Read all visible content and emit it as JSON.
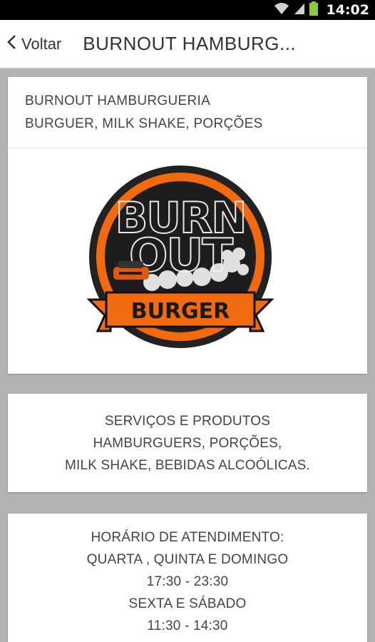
{
  "status_bar": {
    "time": "14:02"
  },
  "header": {
    "back_label": "Voltar",
    "title": "BURNOUT HAMBURG..."
  },
  "intro_card": {
    "lines": [
      "BURNOUT HAMBURGUERIA",
      "BURGUER, MILK SHAKE, PORÇÕES"
    ],
    "logo": {
      "name": "burnout-burger-logo",
      "text_top": "BURN",
      "text_mid": "OUT",
      "banner": "BURGER",
      "accent": "#f26a10",
      "dark": "#1a1a1a"
    }
  },
  "services_card": {
    "lines": [
      "SERVIÇOS E PRODUTOS",
      "HAMBURGUERS, PORÇÕES,",
      "MILK SHAKE, BEBIDAS ALCOÓLICAS."
    ]
  },
  "hours_card": {
    "lines": [
      "HORÁRIO DE ATENDIMENTO:",
      "QUARTA , QUINTA E DOMINGO",
      "17:30 - 23:30",
      "SEXTA E SÁBADO",
      "11:30 - 14:30"
    ]
  }
}
